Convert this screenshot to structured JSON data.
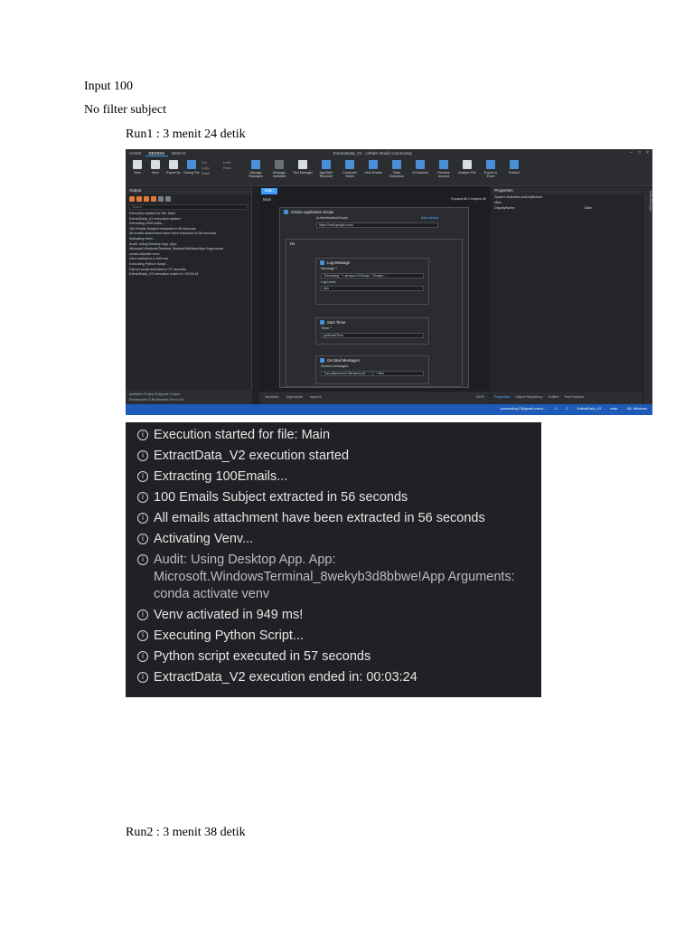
{
  "doc": {
    "line1": "Input 100",
    "line2": "No filter subject",
    "run1": "Run1 : 3 menit 24 detik",
    "run2": "Run2 : 3 menit 38 detik"
  },
  "studio": {
    "tabs": [
      "HOME",
      "DESIGN",
      "DEBUG"
    ],
    "title": "ExtractData_V2 - UiPath Studio Community",
    "ribbon": [
      {
        "label": "New"
      },
      {
        "label": "Save"
      },
      {
        "label": "Export As"
      },
      {
        "label": "Debug File"
      },
      {
        "label": "Manage Packages"
      },
      {
        "label": "Message Variables"
      },
      {
        "label": "Text Manager"
      },
      {
        "label": "App/Web Recorder"
      },
      {
        "label": "Computer Vision"
      },
      {
        "label": "User Events"
      },
      {
        "label": "Table Extraction"
      },
      {
        "label": "UI Explorer"
      },
      {
        "label": "Remove Unused"
      },
      {
        "label": "Analyze File"
      },
      {
        "label": "Export to Excel"
      },
      {
        "label": "Publish"
      }
    ],
    "ribbon_small": [
      "Cut",
      "Copy",
      "Paste",
      "Undo",
      "Redo"
    ],
    "output_panel_title": "Output",
    "search_placeholder": "Search",
    "output_log": [
      "Execution started for file: Main",
      "ExtractData_V2 execution started",
      "Extracting 100Emails...",
      "100 Emails Subject extracted in 56 seconds",
      "All emails attachment have been extracted in 56 seconds",
      "Activating Venv...",
      "Audit: Using Desktop App. App:",
      "Microsoft.WindowsTerminal_8wekyb3d8bbwe!App Arguments:",
      "conda activate venv",
      "Venv activated in 949 ms!",
      "Executing Python Script...",
      "Python script executed in 57 seconds",
      "ExtractData_V2 execution ended in: 00:03:24"
    ],
    "left_tabs": "Activities  Project  Snippets  Output",
    "left_tabs2": "Breakpoints & Bookmarks  Error List",
    "doc_tab": "Main",
    "breadcrumb": "Main",
    "expand": "Expand All   Collapse All",
    "gsuite": {
      "title": "GSuite Application Scope",
      "auth_label": "AuthenticationScope",
      "auth_link": "Auto detect",
      "auth_value": "https://mail.google.com/"
    },
    "do_label": "Do",
    "logmsg": {
      "title": "Log Message",
      "msg_label": "Message *",
      "msg_value": "\"Extracting \" + strInput.ToString + \"Emails...\"",
      "level_label": "Log Level",
      "level_value": "Info"
    },
    "timer": {
      "title": "Start Timer",
      "timer_label": "Timer *",
      "timer_value": "getEmailTime"
    },
    "mail": {
      "title": "Get Mail Messages",
      "search_label": "Search messages",
      "search_value": "\"has:attachment filename:pdf \" + \"(\" + filter"
    },
    "center_bottom": [
      "Variables",
      "Arguments",
      "Imports"
    ],
    "zoom_level": "100%",
    "props_title": "Properties",
    "props_path": "System.Activities.ActivityBuilder",
    "props_section": "Misc",
    "props_key": "DisplayName",
    "props_val": "Main",
    "right_bottom": [
      "Properties",
      "Object Repository",
      "Outline",
      "Test Explorer"
    ],
    "sidebar_label": "Data Manager",
    "status": [
      "jroswodkoy17@gmail.com/s...",
      "0",
      "2",
      "ExtractData_V2",
      "main",
      "VB, Windows"
    ]
  },
  "zoom_log": [
    {
      "text": "Execution started for file: Main",
      "muted": false
    },
    {
      "text": "ExtractData_V2 execution started",
      "muted": false
    },
    {
      "text": "Extracting 100Emails...",
      "muted": false
    },
    {
      "text": "100 Emails Subject extracted in 56 seconds",
      "muted": false
    },
    {
      "text": "All emails attachment have been extracted in 56 seconds",
      "muted": false
    },
    {
      "text": "Activating Venv...",
      "muted": false
    },
    {
      "text": "Audit: Using Desktop App. App:",
      "muted": true
    },
    {
      "text": "Microsoft.WindowsTerminal_8wekyb3d8bbwe!App Arguments:",
      "muted": true
    },
    {
      "text": "conda activate venv",
      "muted": true
    },
    {
      "text": "Venv activated in 949 ms!",
      "muted": false
    },
    {
      "text": "Executing Python Script...",
      "muted": false
    },
    {
      "text": "Python script executed in 57 seconds",
      "muted": false
    },
    {
      "text": "ExtractData_V2 execution ended in: 00:03:24",
      "muted": false
    }
  ],
  "info_icon_glyph": "i",
  "colors": {
    "studio_bg": "#1f2124",
    "accent": "#3d9bff",
    "status_bar": "#1e5ab8",
    "output_bg": "#202124"
  }
}
